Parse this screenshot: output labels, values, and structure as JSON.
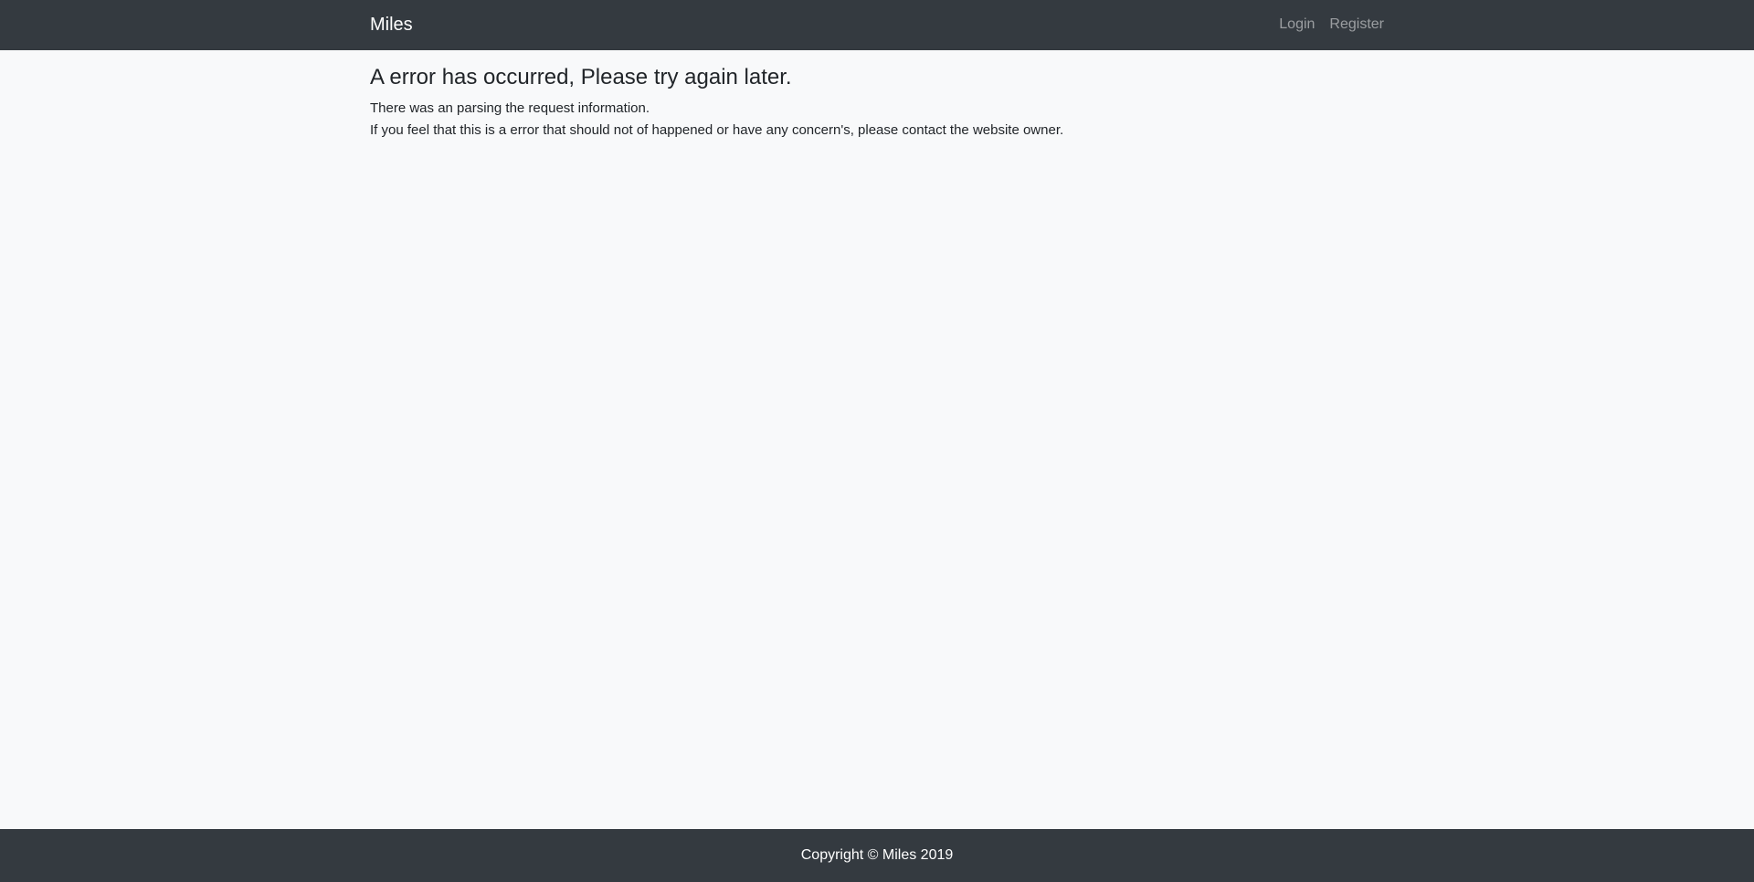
{
  "navbar": {
    "brand": "Miles",
    "links": [
      {
        "label": "Login"
      },
      {
        "label": "Register"
      }
    ]
  },
  "main": {
    "title": "A error has occurred, Please try again later.",
    "line1": "There was an parsing the request information.",
    "line2": "If you feel that this is a error that should not of happened or have any concern's, please contact the website owner."
  },
  "footer": {
    "copyright": "Copyright © Miles 2019"
  },
  "colors": {
    "navbar_bg": "#343a40",
    "page_bg": "#f8f9fa",
    "text": "#212529"
  }
}
